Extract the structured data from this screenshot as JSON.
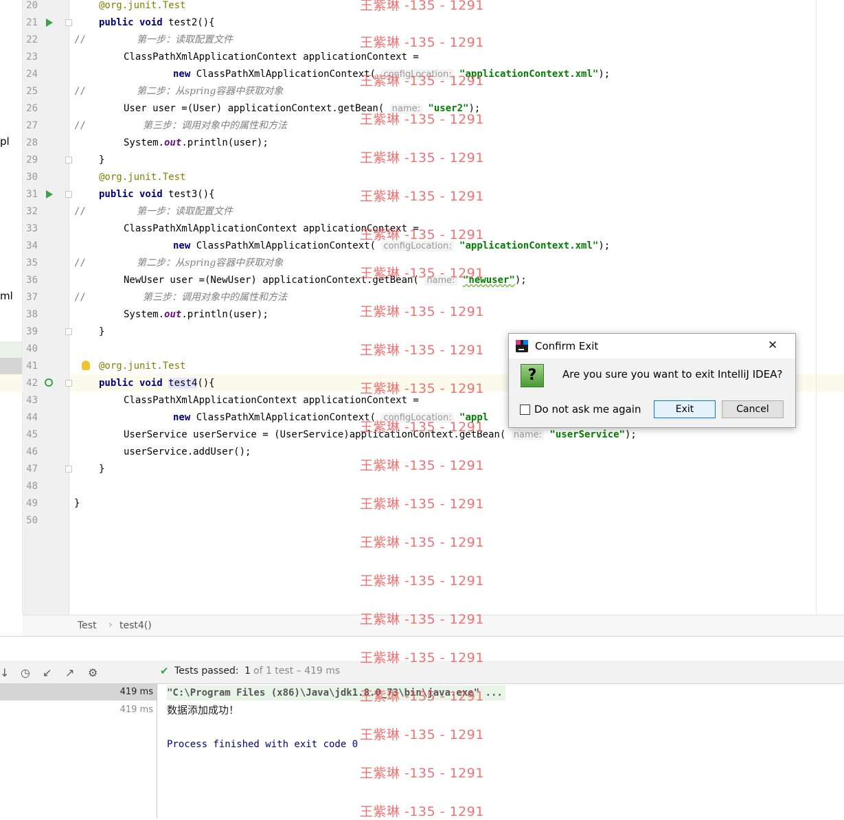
{
  "editor": {
    "line_numbers": [
      "20",
      "21",
      "22",
      "23",
      "24",
      "25",
      "26",
      "27",
      "28",
      "29",
      "30",
      "31",
      "32",
      "33",
      "34",
      "35",
      "36",
      "37",
      "38",
      "39",
      "40",
      "41",
      "42",
      "43",
      "44",
      "45",
      "46",
      "47",
      "48",
      "49",
      "50"
    ],
    "project_fragments": {
      "a": "pl",
      "b": "ml"
    },
    "code": {
      "l20_ann": "@org.junit.",
      "l20_test": "Test",
      "l21_kw": "public void",
      "l21_rest": " test2(){",
      "l22_slash": "//",
      "l22_cmt": "第一步：读取配置文件",
      "l23": "ClassPathXmlApplicationContext applicationContext =",
      "l24_kw": "new",
      "l24_rest": " ClassPathXmlApplicationContext(",
      "l24_hint": "configLocation:",
      "l24_str": "\"applicationContext.xml\"",
      "l24_end": ");",
      "l25_slash": "//",
      "l25_cmt": "第二步：从spring容器中获取对象",
      "l26_rest": "User user =(User) applicationContext.getBean(",
      "l26_hint": "name:",
      "l26_str": "\"user2\"",
      "l26_end": ");",
      "l27_slash": "//",
      "l27_cmt": "第三步：调用对象中的属性和方法",
      "l28_a": "System.",
      "l28_field": "out",
      "l28_b": ".println(user);",
      "l29": "}",
      "l30_ann": "@org.junit.",
      "l30_test": "Test",
      "l31_kw": "public void",
      "l31_rest": " test3(){",
      "l32_slash": "//",
      "l32_cmt": "第一步：读取配置文件",
      "l33": "ClassPathXmlApplicationContext applicationContext =",
      "l34_kw": "new",
      "l34_rest": " ClassPathXmlApplicationContext(",
      "l34_hint": "configLocation:",
      "l34_str": "\"applicationContext.xml\"",
      "l34_end": ");",
      "l35_slash": "//",
      "l35_cmt": "第二步：从spring容器中获取对象",
      "l36_rest": "NewUser user =(NewUser) applicationContext.getBean(",
      "l36_hint": "name:",
      "l36_str": "\"newuser\"",
      "l36_end": ");",
      "l37_slash": "//",
      "l37_cmt": "第三步：调用对象中的属性和方法",
      "l38_a": "System.",
      "l38_field": "out",
      "l38_b": ".println(user);",
      "l39": "}",
      "l41_ann": "@org.junit.",
      "l41_test": "Test",
      "l42_kw": "public void",
      "l42_sp": " ",
      "l42_name": "test4",
      "l42_rest": "(){",
      "l43": "ClassPathXmlApplicationContext applicationContext =",
      "l44_kw": "new",
      "l44_rest": " ClassPathXmlApplicationContext(",
      "l44_hint": "configLocation:",
      "l44_str": "\"appl",
      "l45_rest": "UserService userService = (UserService)applicationContext.getBean(",
      "l45_hint": "name:",
      "l45_str": "\"userService\"",
      "l45_end": ");",
      "l46": "userService.addUser();",
      "l47": "}",
      "l49": "}"
    }
  },
  "breadcrumb": {
    "class": "Test",
    "sep": "›",
    "method": "test4()"
  },
  "run_panel": {
    "status_label": "Tests passed:",
    "status_count": "1",
    "status_rest": "of 1 test – 419 ms",
    "tree_time_1": "419 ms",
    "tree_time_2": "419 ms",
    "console_cmd": "\"C:\\Program Files (x86)\\Java\\jdk1.8.0_73\\bin\\java.exe\" ...",
    "console_out": "数据添加成功！",
    "console_exit": "Process finished with exit code 0"
  },
  "dialog": {
    "title": "Confirm Exit",
    "message": "Are you sure you want to exit IntelliJ IDEA?",
    "checkbox_label": "Do not ask me again",
    "exit_label": "Exit",
    "cancel_label": "Cancel",
    "close_glyph": "✕",
    "question_glyph": "?"
  },
  "watermark": "王紫琳 -135 - 1291",
  "colors": {
    "keyword": "#000080",
    "string": "#008000",
    "annotation": "#808000",
    "comment": "#808080",
    "watermark": "#f05a5a",
    "pass": "#3f9e46"
  }
}
